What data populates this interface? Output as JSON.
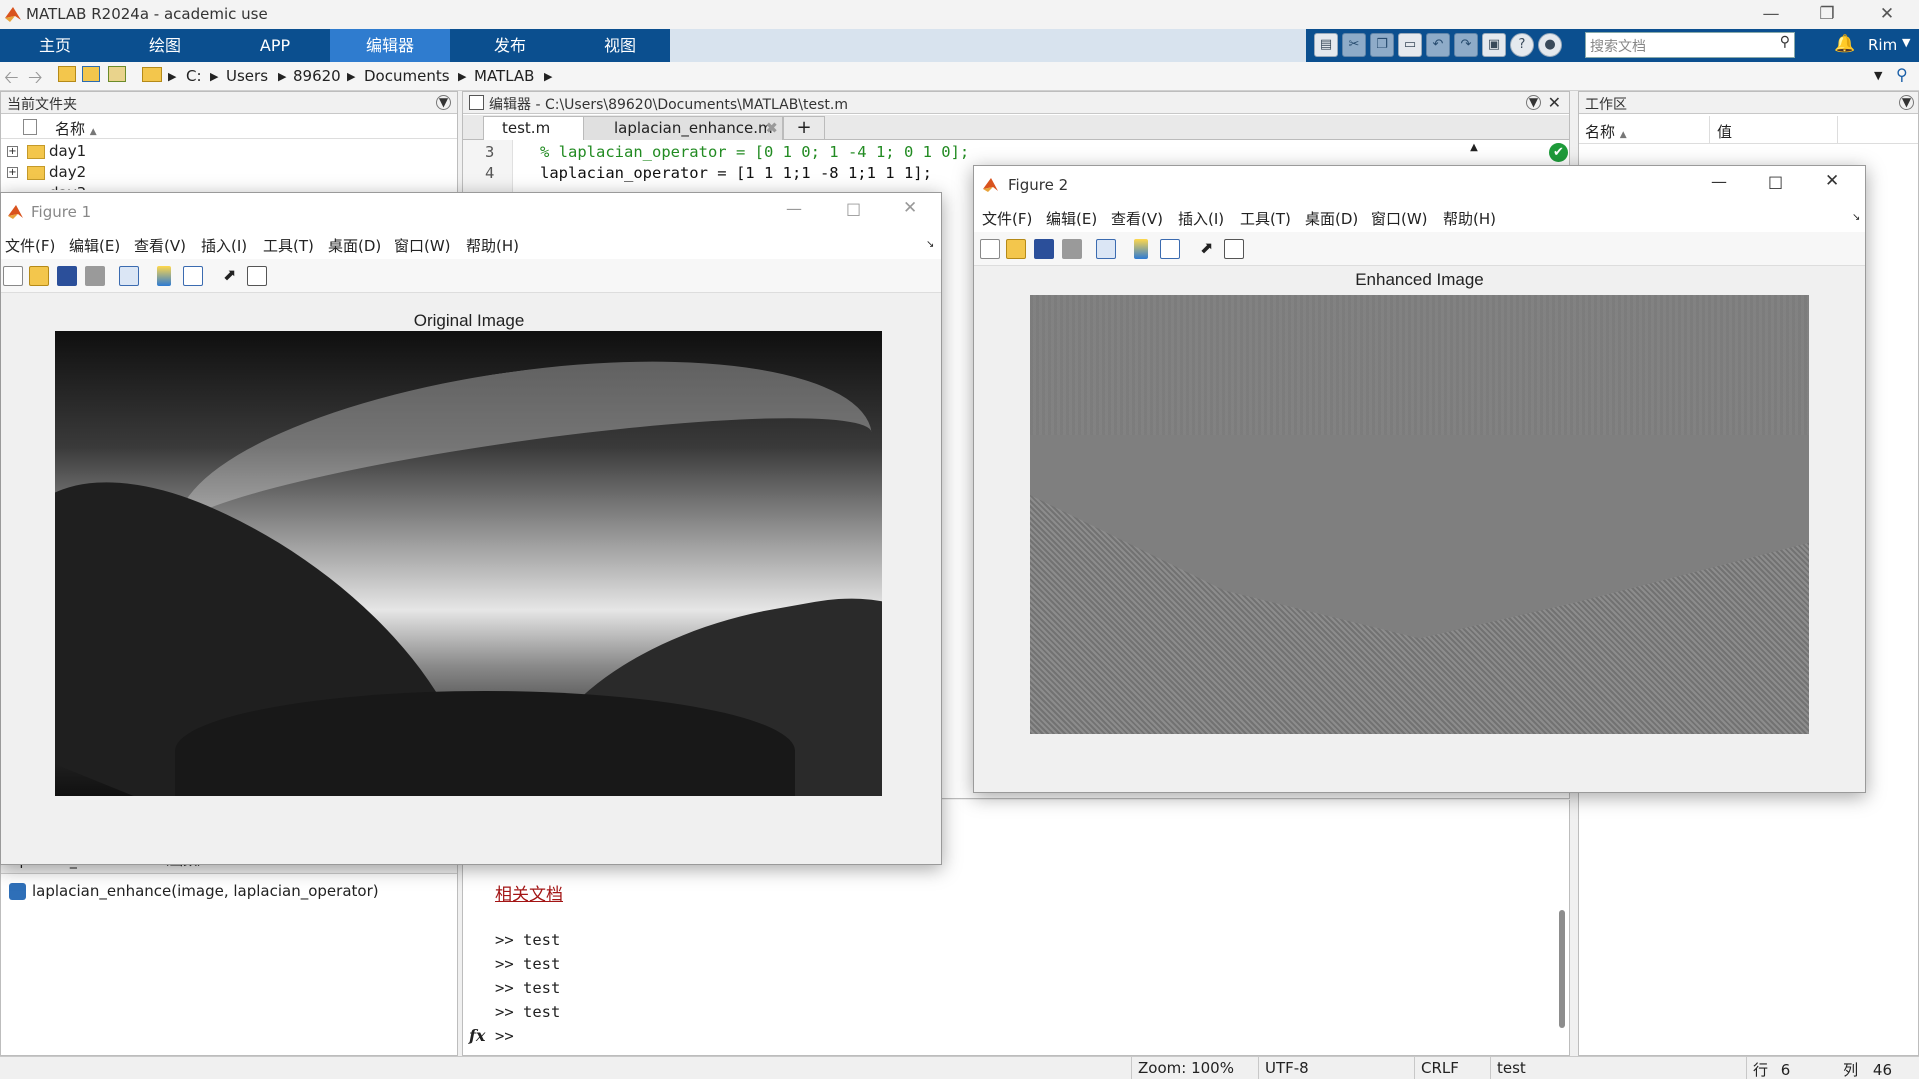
{
  "app": {
    "title": "MATLAB R2024a - academic use"
  },
  "ribbon": {
    "tabs": [
      "主页",
      "绘图",
      "APP",
      "编辑器",
      "发布",
      "视图"
    ],
    "search_placeholder": "搜索文档",
    "user": "Rim"
  },
  "address": {
    "path": [
      "C:",
      "Users",
      "89620",
      "Documents",
      "MATLAB"
    ]
  },
  "current_folder": {
    "title": "当前文件夹",
    "col_name": "名称",
    "items": [
      "day1",
      "day2",
      "day3"
    ],
    "detail_label": "laplacian_enhance.m（函数）",
    "detail_func": "laplacian_enhance(image, laplacian_operator)"
  },
  "editor": {
    "title": "编辑器 - C:\\Users\\89620\\Documents\\MATLAB\\test.m",
    "tabs": [
      "test.m",
      "laplacian_enhance.m"
    ],
    "lines": [
      {
        "num": "3",
        "text": "% laplacian_operator = [0 1 0; 1 -4 1; 0 1 0];",
        "comment": true
      },
      {
        "num": "4",
        "text": "laplacian_operator = [1 1 1;1 -8 1;1 1 1];",
        "comment": false
      }
    ]
  },
  "command_window": {
    "doc_link": "相关文档",
    "history": [
      ">> test",
      ">> test",
      ">> test",
      ">> test"
    ],
    "prompt": ">>"
  },
  "workspace": {
    "title": "工作区",
    "col_name": "名称",
    "col_value": "值"
  },
  "figure1": {
    "title": "Figure 1",
    "menu": [
      "文件(F)",
      "编辑(E)",
      "查看(V)",
      "插入(I)",
      "工具(T)",
      "桌面(D)",
      "窗口(W)",
      "帮助(H)"
    ],
    "axes_title": "Original Image"
  },
  "figure2": {
    "title": "Figure 2",
    "menu": [
      "文件(F)",
      "编辑(E)",
      "查看(V)",
      "插入(I)",
      "工具(T)",
      "桌面(D)",
      "窗口(W)",
      "帮助(H)"
    ],
    "axes_title": "Enhanced Image"
  },
  "status": {
    "zoom": "Zoom: 100%",
    "encoding": "UTF-8",
    "eol": "CRLF",
    "file": "test",
    "row_label": "行",
    "row": "6",
    "col_label": "列",
    "col": "46"
  },
  "colors": {
    "ribbon": "#0b4f8f",
    "ribbon_active": "#2f7ccf",
    "comment": "#228b22",
    "link": "#a31515"
  }
}
